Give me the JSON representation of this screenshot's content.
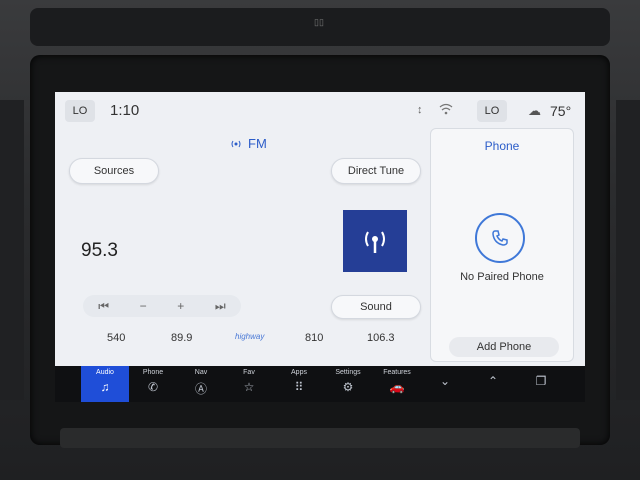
{
  "header": {
    "left_zone_label": "LO",
    "time": "1:10",
    "right_zone_label": "LO",
    "outside_temp": "75°"
  },
  "audio": {
    "source_band": "FM",
    "sources_label": "Sources",
    "direct_tune_label": "Direct Tune",
    "frequency": "95.3",
    "sound_label": "Sound",
    "controls": [
      "⏮",
      "−",
      "+",
      "⏭"
    ],
    "presets": [
      "540",
      "89.9",
      "810",
      "106.3"
    ],
    "preset_logo_text": "highway"
  },
  "phone": {
    "title": "Phone",
    "status": "No Paired Phone",
    "add_label": "Add Phone"
  },
  "nav": {
    "items": [
      {
        "label": "Audio",
        "icon": "music-note-icon",
        "active": true
      },
      {
        "label": "Phone",
        "icon": "phone-icon",
        "active": false
      },
      {
        "label": "Nav",
        "icon": "navigation-icon",
        "active": false
      },
      {
        "label": "Fav",
        "icon": "star-icon",
        "active": false
      },
      {
        "label": "Apps",
        "icon": "apps-grid-icon",
        "active": false
      },
      {
        "label": "Settings",
        "icon": "settings-icon",
        "active": false
      },
      {
        "label": "Features",
        "icon": "car-icon",
        "active": false
      }
    ]
  },
  "colors": {
    "accent": "#2c5dc9",
    "active_nav": "#1f4ed8",
    "station_art": "#253e96"
  }
}
